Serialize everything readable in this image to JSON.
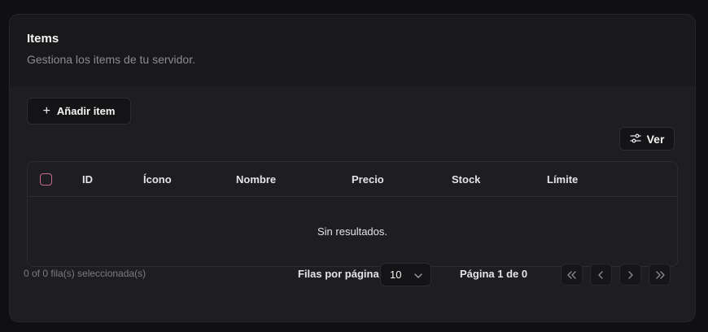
{
  "header": {
    "title": "Items",
    "subtitle": "Gestiona los items de tu servidor."
  },
  "toolbar": {
    "add_label": "Añadir item",
    "add_icon": "plus-icon",
    "view_label": "Ver",
    "view_icon": "sliders-icon"
  },
  "table": {
    "columns": [
      "ID",
      "Ícono",
      "Nombre",
      "Precio",
      "Stock",
      "Límite"
    ],
    "empty_text": "Sin resultados."
  },
  "footer": {
    "selection_text": "0 of 0 fila(s) seleccionada(s)",
    "rows_label": "Filas por página",
    "rows_value": "10",
    "page_text": "Página 1 de 0"
  },
  "colors": {
    "checkbox_border": "#c56a8c",
    "card_bg": "#1e1e22",
    "header_bg": "#19191c"
  }
}
